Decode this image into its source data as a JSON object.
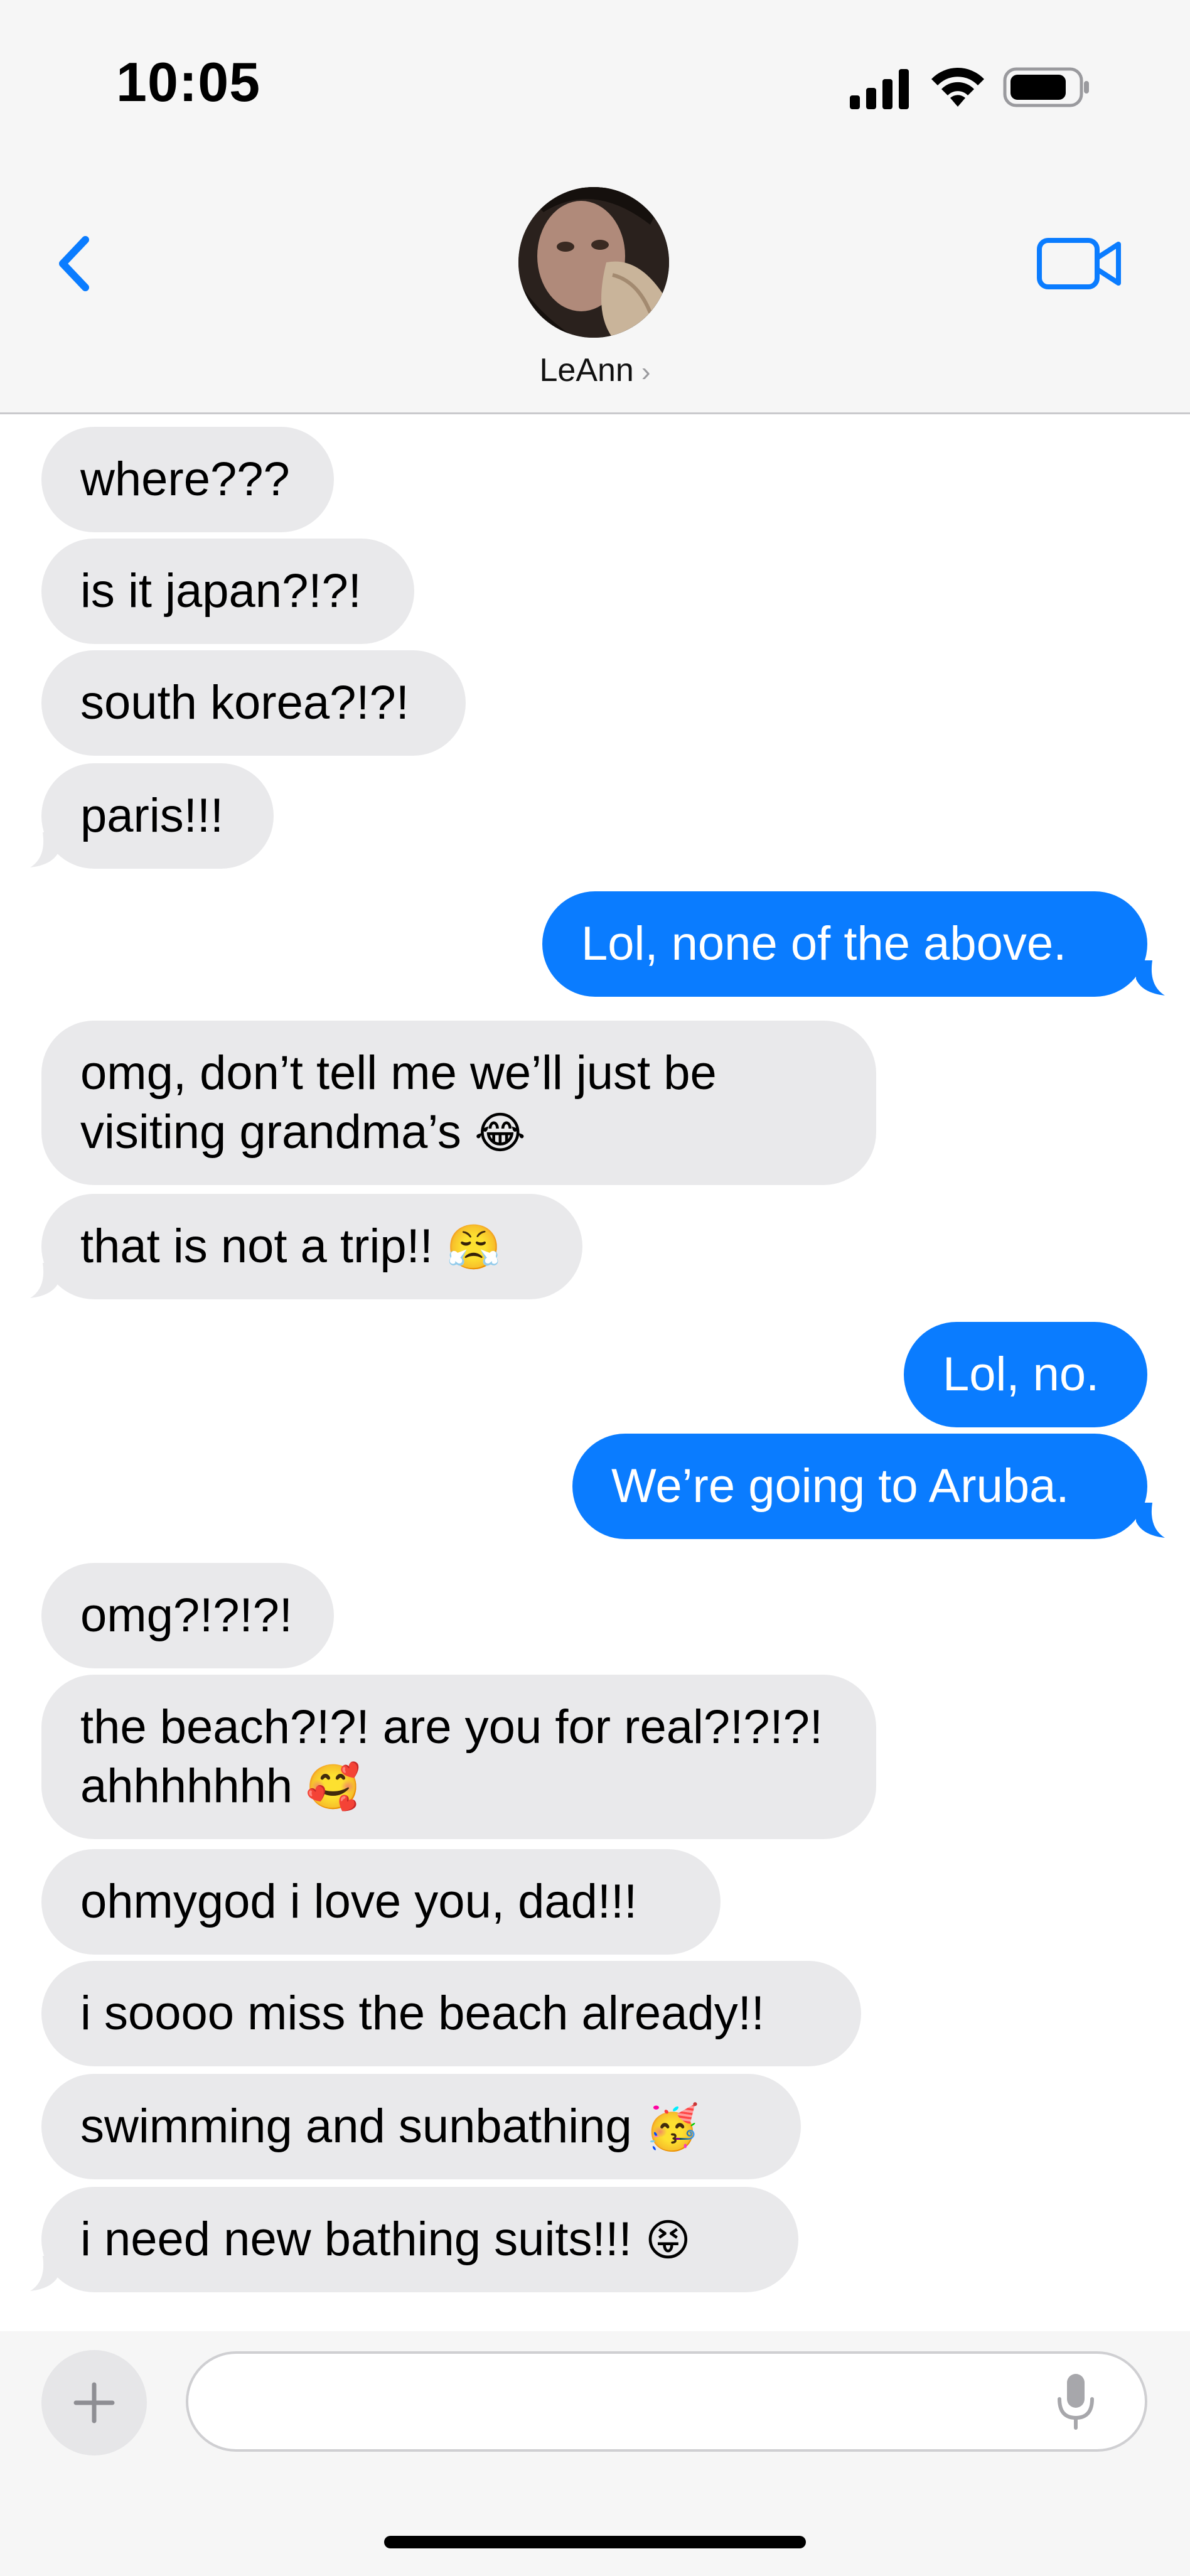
{
  "status_bar": {
    "time": "10:05"
  },
  "header": {
    "contact_name": "LeAnn",
    "chevron": "›",
    "back_icon": "chevron-left-icon",
    "video_icon": "video-camera-icon",
    "accent_color": "#0a7cff"
  },
  "messages": [
    {
      "from": "them",
      "text": "where???"
    },
    {
      "from": "them",
      "text": "is it japan?!?!"
    },
    {
      "from": "them",
      "text": "south korea?!?!"
    },
    {
      "from": "them",
      "text": "paris!!!"
    },
    {
      "from": "me",
      "text": "Lol, none of the above."
    },
    {
      "from": "them",
      "text": "omg, don’t tell me we’ll just be visiting grandma’s",
      "emoji": "😂"
    },
    {
      "from": "them",
      "text": "that is not a trip!!",
      "emoji": "😤"
    },
    {
      "from": "me",
      "text": "Lol, no."
    },
    {
      "from": "me",
      "text": "We’re going to Aruba."
    },
    {
      "from": "them",
      "text": "omg?!?!?!"
    },
    {
      "from": "them",
      "text": "the beach?!?! are you for real?!?!?! ahhhhhhh",
      "emoji": "🥰"
    },
    {
      "from": "them",
      "text": "ohmygod i love you, dad!!!"
    },
    {
      "from": "them",
      "text": "i soooo miss the beach already!!"
    },
    {
      "from": "them",
      "text": "swimming and sunbathing",
      "emoji": "🥳"
    },
    {
      "from": "them",
      "text": "i need new bathing suits!!!",
      "emoji": "😝"
    }
  ],
  "composer": {
    "value": "",
    "placeholder": "",
    "plus_label": "+",
    "mic_icon": "microphone-icon"
  },
  "colors": {
    "received_bubble": "#e9e9eb",
    "sent_bubble": "#0a7cff"
  }
}
